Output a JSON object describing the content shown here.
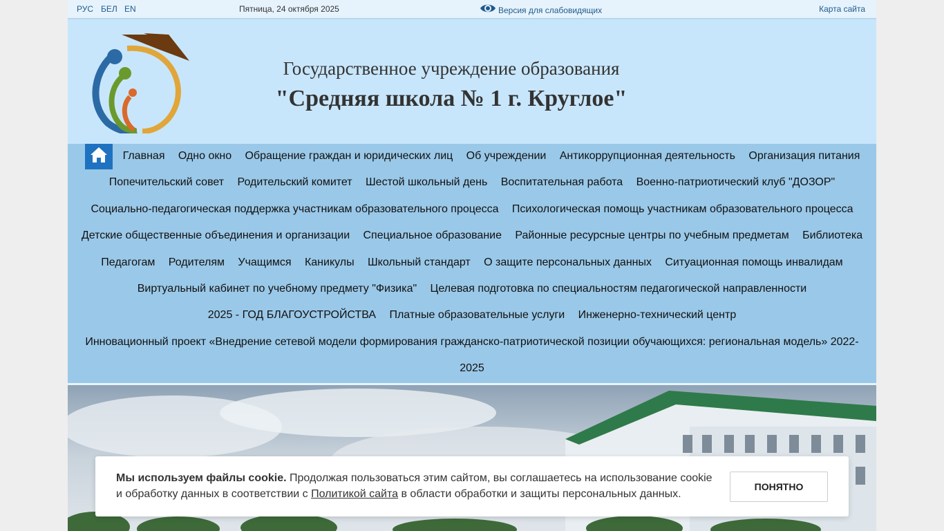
{
  "topbar": {
    "lang_ru": "РУС",
    "lang_be": "БЕЛ",
    "lang_en": "EN",
    "date": "Пятница, 24 октября 2025",
    "vision_label": "Версия для слабовидящих",
    "sitemap": "Карта сайта"
  },
  "header": {
    "line1": "Государственное учреждение образования",
    "line2": "\"Средняя школа № 1 г. Круглое\""
  },
  "nav": {
    "home_icon": "home-icon",
    "rows": [
      [
        "Главная",
        "Одно окно",
        "Обращение граждан и юридических лиц",
        "Об учреждении",
        "Антикоррупционная деятельность",
        "Организация питания"
      ],
      [
        "Попечительский совет",
        "Родительский комитет",
        "Шестой школьный день",
        "Воспитательная работа",
        "Военно-патриотический клуб \"ДОЗОР\""
      ],
      [
        "Социально-педагогическая поддержка участникам образовательного процесса",
        "Психологическая помощь участникам образовательного процесса"
      ],
      [
        "Детские общественные объединения и организации",
        "Специальное образование",
        "Районные ресурсные центры по учебным предметам",
        "Библиотека"
      ],
      [
        "Педагогам",
        "Родителям",
        "Учащимся",
        "Каникулы",
        "Школьный стандарт",
        "О защите персональных данных",
        "Ситуационная помощь инвалидам"
      ],
      [
        "Виртуальный кабинет по учебному предмету \"Физика\"",
        "Целевая подготовка по специальностям педагогической направленности"
      ],
      [
        "2025 - ГОД БЛАГОУСТРОЙСТВА",
        "Платные образовательные услуги",
        "Инженерно-технический центр"
      ],
      [
        "Инновационный проект «Внедрение сетевой модели формирования гражданско-патриотической позиции обучающихся: региональная модель» 2022-"
      ],
      [
        "2025"
      ]
    ]
  },
  "cookie": {
    "bold": "Мы используем файлы cookie.",
    "text1": " Продолжая пользоваться этим сайтом, вы соглашаетесь на использование cookie и обработку данных в соответствии с ",
    "link": "Политикой сайта",
    "text2": " в области обработки и защиты персональных данных.",
    "button": "ПОНЯТНО"
  },
  "colors": {
    "header_bg": "#c8e6fb",
    "nav_bg": "#9ac8e8",
    "home_btn": "#1f72c0",
    "link": "#1f5a8a"
  }
}
